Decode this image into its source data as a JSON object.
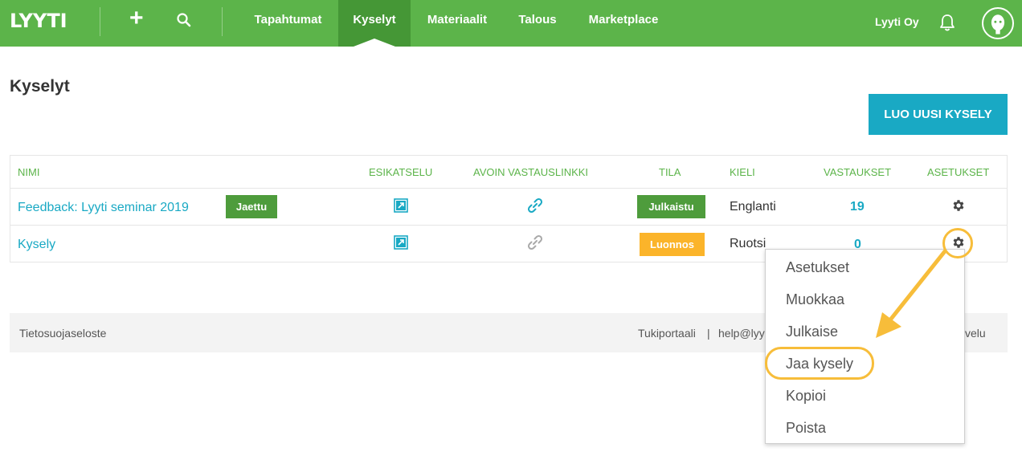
{
  "nav": {
    "logo": "LYYTI",
    "items": [
      "Tapahtumat",
      "Kyselyt",
      "Materiaalit",
      "Talous",
      "Marketplace"
    ],
    "active": "Kyselyt",
    "org": "Lyyti Oy"
  },
  "page": {
    "title": "Kyselyt",
    "create_button": "LUO UUSI KYSELY"
  },
  "table": {
    "columns": [
      "NIMI",
      "ESIKATSELU",
      "AVOIN VASTAUSLINKKI",
      "TILA",
      "KIELI",
      "VASTAUKSET",
      "ASETUKSET"
    ],
    "rows": [
      {
        "name": "Feedback: Lyyti seminar 2019",
        "badge": "Jaettu",
        "status": "Julkaistu",
        "language": "Englanti",
        "responses": "19"
      },
      {
        "name": "Kysely",
        "badge": "",
        "status": "Luonnos",
        "language": "Ruotsi",
        "responses": "0"
      }
    ]
  },
  "footer": {
    "privacy": "Tietosuojaseloste",
    "support": "Tukiportaali",
    "separator": "|",
    "email_visible": "help@lyy",
    "tail_visible": "velu"
  },
  "menu": {
    "items": [
      "Asetukset",
      "Muokkaa",
      "Julkaise",
      "Jaa kysely",
      "Kopioi",
      "Poista"
    ],
    "highlighted": "Jaa kysely"
  },
  "colors": {
    "brand_green": "#5cb44a",
    "active_green": "#459736",
    "link_blue": "#19a9c4",
    "status_green": "#4e9c3c",
    "status_orange": "#fbb42a",
    "annotation_yellow": "#f7bd3a"
  }
}
